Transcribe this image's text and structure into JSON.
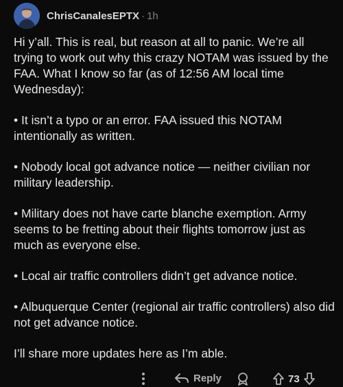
{
  "comment": {
    "username": "ChrisCanalesEPTX",
    "separator": "·",
    "time": "1h",
    "paragraphs": [
      "Hi y’all. This is real, but reason at all to panic. We’re all trying to work out why this crazy NOTAM was issued by the FAA. What I know so far (as of 12:56 AM local time Wednesday):",
      "• It isn’t a typo or an error. FAA issued this NOTAM intentionally as written.",
      "• Nobody local got advance notice — neither civilian nor military leadership.",
      "• Military does not have carte blanche exemption. Army seems to be fretting about their flights tomorrow just as much as everyone else.",
      "• Local air traffic controllers didn’t get advance notice.",
      "• Albuquerque Center (regional air traffic controllers) also did not get advance notice.",
      "I’ll share more updates here as I’m able."
    ],
    "actions": {
      "reply_label": "Reply",
      "vote_count": "73"
    },
    "icons": {
      "more": "more-vertical-icon",
      "reply": "reply-arrow-icon",
      "award": "award-icon",
      "upvote": "upvote-arrow-icon",
      "downvote": "downvote-arrow-icon"
    },
    "colors": {
      "background": "#0b0b0b",
      "text": "#e4e6e7",
      "muted": "#818384",
      "avatar": "#3a5fa8"
    }
  }
}
